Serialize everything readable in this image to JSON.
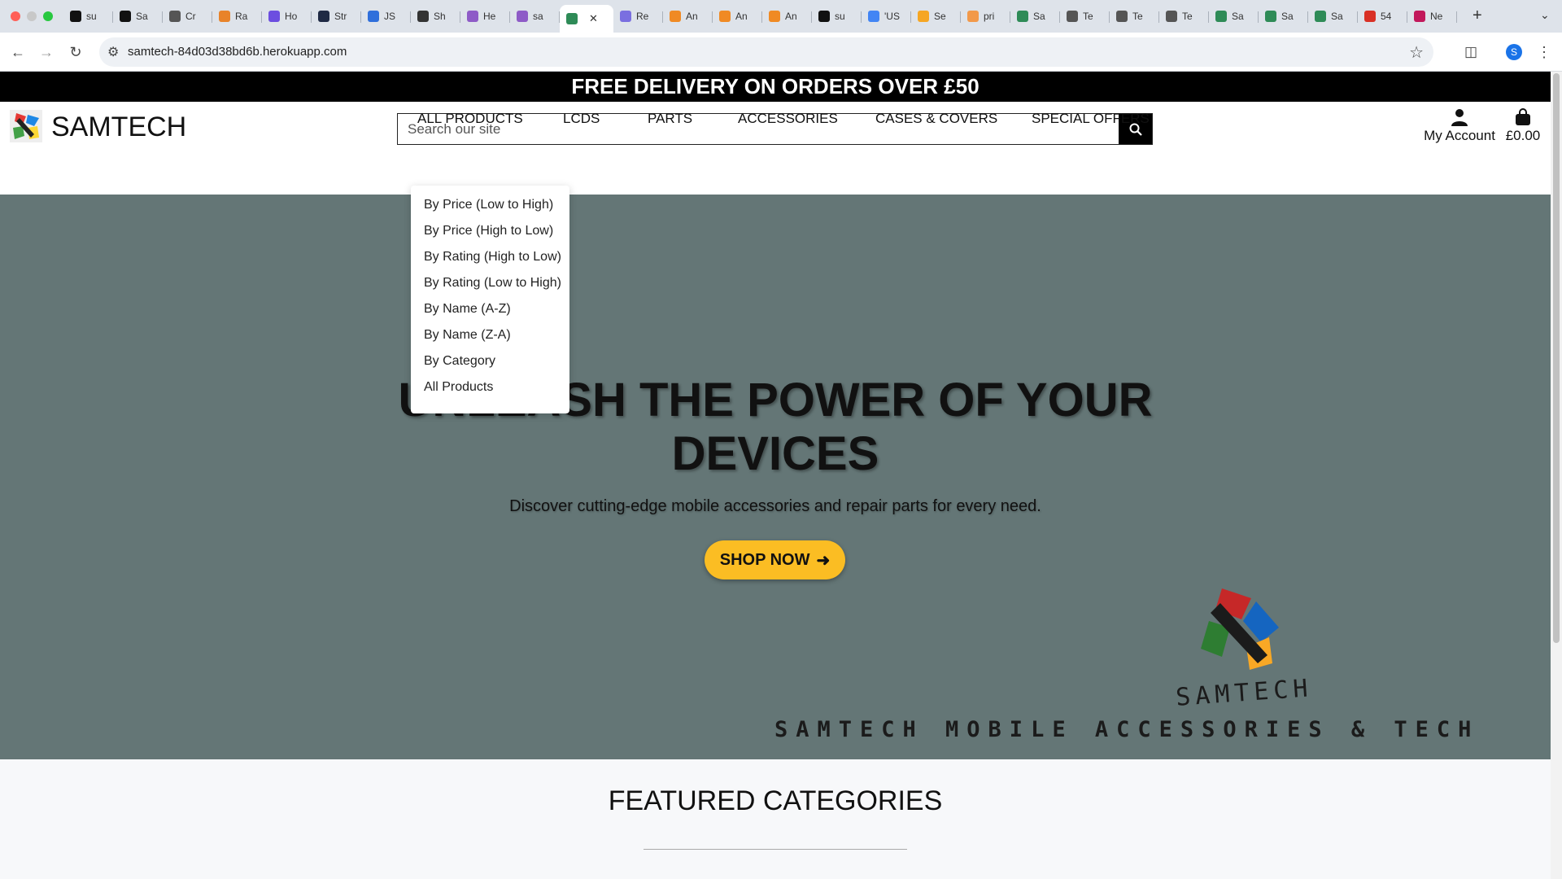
{
  "browser": {
    "tabs": [
      {
        "label": "su",
        "icon": "github-icon",
        "color": "#111111"
      },
      {
        "label": "Sa",
        "icon": "github-icon",
        "color": "#111111"
      },
      {
        "label": "Cr",
        "icon": "globe-icon",
        "color": "#555555"
      },
      {
        "label": "Ra",
        "icon": "image-icon",
        "color": "#e8832a"
      },
      {
        "label": "Ho",
        "icon": "s-app-icon",
        "color": "#6c4ee0"
      },
      {
        "label": "Str",
        "icon": "s-app-icon",
        "color": "#1f2a44"
      },
      {
        "label": "JS",
        "icon": "checkbox-icon",
        "color": "#2f6fdb"
      },
      {
        "label": "Sh",
        "icon": "shield-icon",
        "color": "#333333"
      },
      {
        "label": "He",
        "icon": "h-app-icon",
        "color": "#8e5bc7"
      },
      {
        "label": "sa",
        "icon": "h-app-icon",
        "color": "#8e5bc7"
      },
      {
        "label": "",
        "icon": "samtech-icon",
        "color": "#2e8b57",
        "active": true
      },
      {
        "label": "Re",
        "icon": "cube-icon",
        "color": "#7a6fe0"
      },
      {
        "label": "An",
        "icon": "cube-icon",
        "color": "#f08a24"
      },
      {
        "label": "An",
        "icon": "cube-icon",
        "color": "#f08a24"
      },
      {
        "label": "An",
        "icon": "cube-icon",
        "color": "#f08a24"
      },
      {
        "label": "su",
        "icon": "github-icon",
        "color": "#111111"
      },
      {
        "label": "'US",
        "icon": "google-icon",
        "color": "#4285f4"
      },
      {
        "label": "Se",
        "icon": "chart-icon",
        "color": "#f6a623"
      },
      {
        "label": "pri",
        "icon": "g-app-icon",
        "color": "#f2994a"
      },
      {
        "label": "Sa",
        "icon": "samtech-icon",
        "color": "#2e8b57"
      },
      {
        "label": "Te",
        "icon": "globe-icon",
        "color": "#555555"
      },
      {
        "label": "Te",
        "icon": "globe-icon",
        "color": "#555555"
      },
      {
        "label": "Te",
        "icon": "globe-icon",
        "color": "#555555"
      },
      {
        "label": "Sa",
        "icon": "samtech-icon",
        "color": "#2e8b57"
      },
      {
        "label": "Sa",
        "icon": "samtech-icon",
        "color": "#2e8b57"
      },
      {
        "label": "Sa",
        "icon": "samtech-icon",
        "color": "#2e8b57"
      },
      {
        "label": "54",
        "icon": "gmail-icon",
        "color": "#d93025"
      },
      {
        "label": "Ne",
        "icon": "app-icon",
        "color": "#c2185b"
      }
    ],
    "url": "samtech-84d03d38bd6b.herokuapp.com",
    "profile_initial": "S"
  },
  "site": {
    "banner": "FREE DELIVERY ON ORDERS OVER £50",
    "brand": "SAMTECH",
    "search_placeholder": "Search our site",
    "account_label": "My Account",
    "cart_total": "£0.00",
    "nav": [
      "ALL PRODUCTS",
      "LCDS",
      "PARTS",
      "ACCESSORIES",
      "CASES & COVERS",
      "SPECIAL OFFERS"
    ],
    "dropdown": [
      "By Price (Low to High)",
      "By Price (High to Low)",
      "By Rating (High to Low)",
      "By Rating (Low to High)",
      "By Name (A-Z)",
      "By Name (Z-A)",
      "By Category",
      "All Products"
    ],
    "hero_title_line1": "UNLEASH THE POWER OF YOUR",
    "hero_title_line2": "DEVICES",
    "hero_subtitle": "Discover cutting-edge mobile accessories and repair parts for every need.",
    "shop_button": "SHOP NOW",
    "hero_logo_text": "SAMTECH",
    "hero_tagline": "SAMTECH MOBILE ACCESSORIES & TECH",
    "featured_title": "FEATURED CATEGORIES",
    "colors": {
      "banner": "#000000",
      "hero_bg": "#647676",
      "accent": "#fbbd23"
    }
  }
}
